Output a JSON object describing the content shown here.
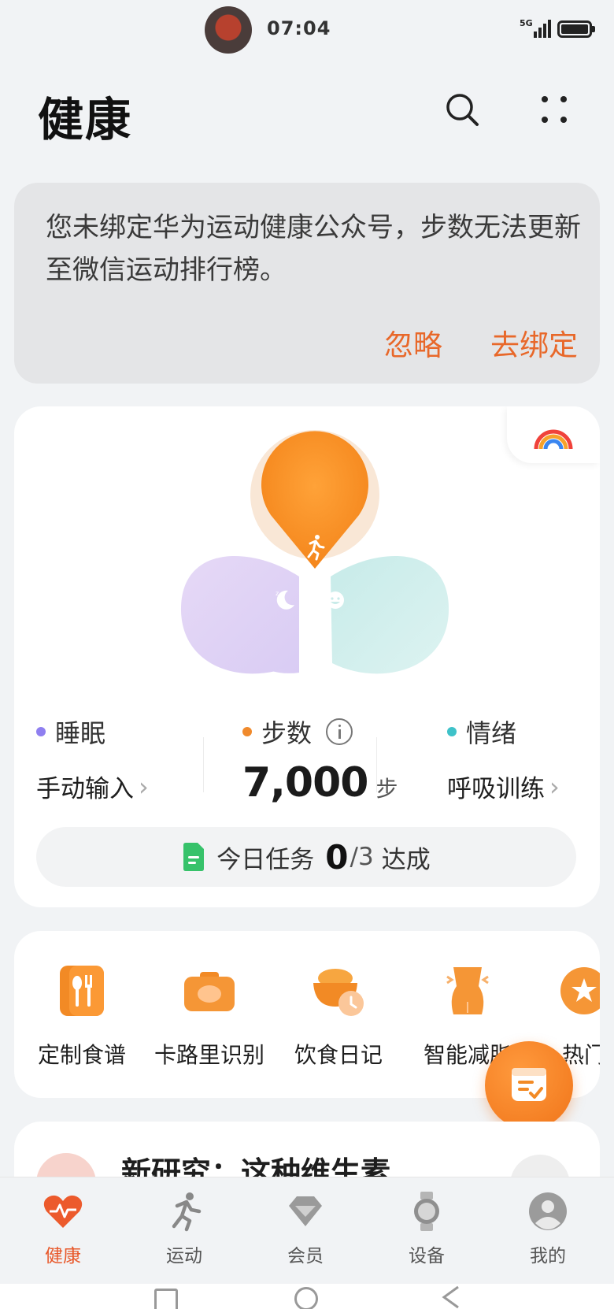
{
  "status_bar": {
    "time": "07:04",
    "network": "5G"
  },
  "header": {
    "title": "健康"
  },
  "notice": {
    "message": "您未绑定华为运动健康公众号，步数无法更新至微信运动排行榜。",
    "ignore_label": "忽略",
    "bind_label": "去绑定",
    "accent": "#e8682a"
  },
  "health_ring": {
    "sleep": {
      "label": "睡眠",
      "action": "手动输入",
      "color": "#8f7ff0"
    },
    "steps": {
      "label": "步数",
      "value": "7,000",
      "unit": "步",
      "color": "#f08a2c"
    },
    "mood": {
      "label": "情绪",
      "action": "呼吸训练",
      "color": "#3ec2c9"
    },
    "tasks": {
      "label": "今日任务",
      "done": "0",
      "total": "/3",
      "suffix": "达成"
    }
  },
  "shortcuts": [
    {
      "label": "定制食谱",
      "icon": "fork-spoon-icon"
    },
    {
      "label": "卡路里识别",
      "icon": "camera-icon"
    },
    {
      "label": "饮食日记",
      "icon": "bowl-clock-icon"
    },
    {
      "label": "智能减脂",
      "icon": "body-icon"
    },
    {
      "label": "热门",
      "icon": "star-icon"
    }
  ],
  "article": {
    "title": "新研究：这种维生素.."
  },
  "bottom_nav": {
    "items": [
      {
        "label": "健康",
        "icon": "heart-icon",
        "active": true
      },
      {
        "label": "运动",
        "icon": "runner-icon",
        "active": false
      },
      {
        "label": "会员",
        "icon": "diamond-icon",
        "active": false
      },
      {
        "label": "设备",
        "icon": "watch-icon",
        "active": false
      },
      {
        "label": "我的",
        "icon": "profile-icon",
        "active": false
      }
    ],
    "active_color": "#e8582a"
  }
}
